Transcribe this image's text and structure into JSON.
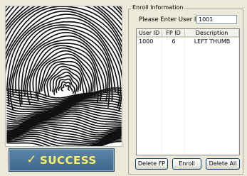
{
  "status": {
    "text": "SUCCESS",
    "check_glyph": "✓",
    "text_color": "#FFF26A",
    "background": "#4A7198"
  },
  "enroll_group": {
    "title": "Enroll Information",
    "user_id_label": "Please Enter User ID :",
    "user_id_value": "1001"
  },
  "list": {
    "columns": [
      "User ID",
      "FP ID",
      "Description"
    ],
    "rows": [
      {
        "user_id": "1000",
        "fp_id": "6",
        "description": "LEFT THUMB"
      }
    ]
  },
  "buttons": {
    "delete_fp": "Delete FP",
    "enroll": "Enroll",
    "delete_all": "Delete All"
  },
  "fingerprint": {
    "icon": "fingerprint-image"
  }
}
